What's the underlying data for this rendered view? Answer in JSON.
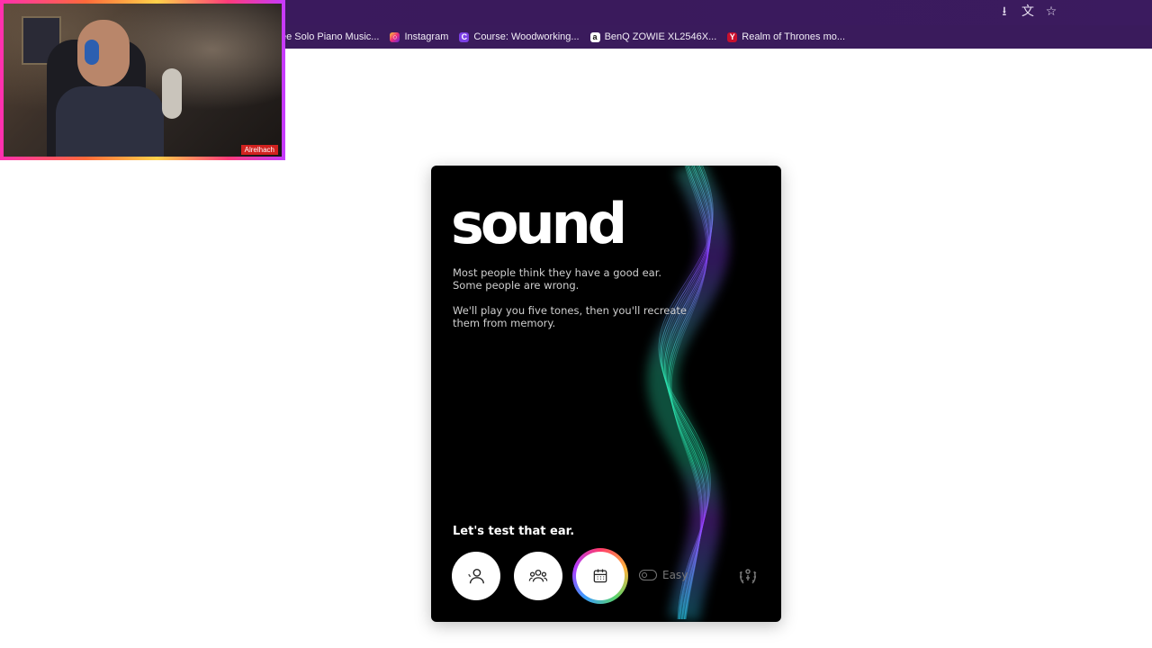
{
  "browser": {
    "bookmarks": [
      {
        "label": "ee Solo Piano Music...",
        "icon": "music-icon",
        "color": "#3b1b5f"
      },
      {
        "label": "Instagram",
        "icon": "instagram-icon",
        "color": "#e1306c"
      },
      {
        "label": "Course: Woodworking...",
        "icon": "course-icon",
        "color": "#7b3fe4"
      },
      {
        "label": "BenQ ZOWIE XL2546X...",
        "icon": "amazon-icon",
        "color": "#ffffff"
      },
      {
        "label": "Realm of Thrones mo...",
        "icon": "realm-icon",
        "color": "#c8102e"
      }
    ],
    "toolbar_icons": [
      "download-icon",
      "translate-icon",
      "star-icon"
    ]
  },
  "webcam": {
    "tag": "Alrelhach"
  },
  "card": {
    "title": "sound",
    "paragraph1": "Most people think they have a good ear. Some people are wrong.",
    "paragraph2": "We'll play you five tones, then you'll recreate them from memory.",
    "cta": "Let's test that ear.",
    "modes": [
      {
        "name": "single-player",
        "icon": "user-icon"
      },
      {
        "name": "multiplayer",
        "icon": "users-icon"
      },
      {
        "name": "daily",
        "icon": "calendar-icon"
      }
    ],
    "difficulty_toggle_label": "Easy",
    "difficulty_toggle_on": false,
    "leaderboard_icon": "laurel-icon"
  },
  "colors": {
    "card_bg": "#000000",
    "browser_bar": "#3a1b5c",
    "wave_teal": "#2de2b0",
    "wave_purple": "#8a3cff"
  }
}
